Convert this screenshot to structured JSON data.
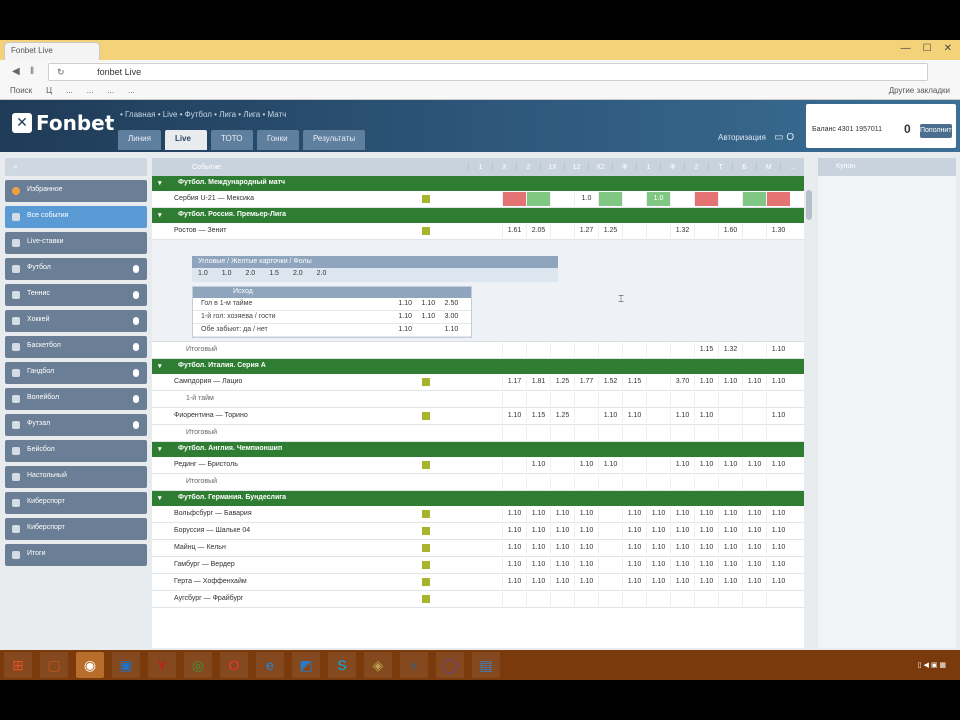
{
  "browser": {
    "tab_title": "Fonbet Live",
    "url_site": "fonbet Live",
    "nav_back": "◀",
    "nav_pause": "‖",
    "window_controls": [
      "—",
      "☐",
      "✕"
    ],
    "bookmarks": [
      "Поиск",
      "Ц",
      "...",
      "...",
      "...",
      "..."
    ],
    "bookmarks_right": "Другие закладки"
  },
  "site": {
    "logo": "Fonbet",
    "breadcrumb": "• Главная • Live • Футбол • Лига • Лига • Матч",
    "tabs": [
      {
        "label": "Линия"
      },
      {
        "label": "Live"
      },
      {
        "label": "ТОТО"
      },
      {
        "label": "Гонки"
      },
      {
        "label": "Результаты"
      }
    ],
    "header_right_label": "Авторизация",
    "header_right_icon": "▭ O",
    "account": {
      "id_label": "Баланс 4301 1957011",
      "balance": "0",
      "deposit_label": "Пополнить"
    }
  },
  "sidebar": {
    "search_icon": "search-icon",
    "items": [
      {
        "label": "Избранное",
        "icon": "orange"
      },
      {
        "label": "Все события",
        "icon": "default"
      },
      {
        "label": "Live-ставки",
        "icon": "default"
      },
      {
        "label": "Футбол",
        "icon": "default"
      },
      {
        "label": "Теннис",
        "icon": "default"
      },
      {
        "label": "Хоккей",
        "icon": "default"
      },
      {
        "label": "Баскетбол",
        "icon": "default"
      },
      {
        "label": "Гандбол",
        "icon": "default"
      },
      {
        "label": "Волейбол",
        "icon": "default"
      },
      {
        "label": "Футзал",
        "icon": "default"
      },
      {
        "label": "Бейсбол",
        "icon": "default"
      },
      {
        "label": "Настольный",
        "icon": "default"
      },
      {
        "label": "Киберспорт",
        "icon": "default"
      },
      {
        "label": "Киберспорт",
        "icon": "default"
      },
      {
        "label": "Итоги",
        "icon": "default"
      }
    ]
  },
  "table": {
    "header_label": "Событие",
    "columns": [
      "1",
      "X",
      "2",
      "1X",
      "12",
      "X2",
      "Ф",
      "1",
      "Ф",
      "2",
      "Т",
      "Б",
      "М",
      "..."
    ],
    "rows": [
      {
        "type": "section",
        "label": "Футбол. Международный матч"
      },
      {
        "type": "event",
        "name": "Сербия U-21 — Мексика",
        "odds": [
          "",
          "",
          "",
          "1.0",
          "",
          "",
          "1.0",
          "",
          "",
          "",
          "",
          ""
        ],
        "hl": [
          "r",
          "g",
          "",
          "",
          "g",
          "",
          "g",
          "",
          "r",
          "",
          "g",
          "r"
        ]
      },
      {
        "type": "section",
        "label": "Футбол. Россия. Премьер-Лига"
      },
      {
        "type": "event",
        "name": "Ростов — Зенит",
        "odds": [
          "1.61",
          "2.05",
          "",
          "1.27",
          "1.25",
          "",
          "",
          "1.32",
          "",
          "1.60",
          "",
          "1.30"
        ],
        "hl": []
      },
      {
        "type": "expand"
      },
      {
        "type": "sub",
        "name": "Итоговый",
        "odds": [
          "",
          "",
          "",
          "",
          "",
          "",
          "",
          "",
          "1.15",
          "1.32",
          "",
          "1.10"
        ],
        "hl": []
      },
      {
        "type": "section",
        "label": "Футбол. Италия. Серия А"
      },
      {
        "type": "event",
        "name": "Сампдория — Лацио",
        "odds": [
          "1.17",
          "1.81",
          "1.25",
          "1.77",
          "1.52",
          "1.15",
          "",
          "3.70",
          "1.10",
          "1.10",
          "1.10",
          "1.10"
        ],
        "hl": []
      },
      {
        "type": "sub",
        "name": "1-й тайм",
        "odds": [
          "",
          "",
          "",
          "",
          "",
          "",
          "",
          "",
          "",
          "",
          "",
          ""
        ],
        "hl": []
      },
      {
        "type": "event",
        "name": "Фиорентина — Торино",
        "odds": [
          "1.10",
          "1.15",
          "1.25",
          "",
          "1.10",
          "1.10",
          "",
          "1.10",
          "1.10",
          "",
          "",
          "1.10"
        ],
        "hl": []
      },
      {
        "type": "sub",
        "name": "Итоговый",
        "odds": [
          "",
          "",
          "",
          "",
          "",
          "",
          "",
          "",
          "",
          "",
          "",
          ""
        ],
        "hl": []
      },
      {
        "type": "section",
        "label": "Футбол. Англия. Чемпионшип"
      },
      {
        "type": "event",
        "name": "Рединг — Бристоль",
        "odds": [
          "",
          "1.10",
          "",
          "1.10",
          "1.10",
          "",
          "",
          "1.10",
          "1.10",
          "1.10",
          "1.10",
          "1.10"
        ],
        "hl": []
      },
      {
        "type": "sub",
        "name": "Итоговый",
        "odds": [
          "",
          "",
          "",
          "",
          "",
          "",
          "",
          "",
          "",
          "",
          "",
          ""
        ],
        "hl": []
      },
      {
        "type": "section",
        "label": "Футбол. Германия. Бундеслига"
      },
      {
        "type": "event",
        "name": "Вольфсбург — Бавария",
        "odds": [
          "1.10",
          "1.10",
          "1.10",
          "1.10",
          "",
          "1.10",
          "1.10",
          "1.10",
          "1.10",
          "1.10",
          "1.10",
          "1.10"
        ],
        "hl": []
      },
      {
        "type": "event",
        "name": "Боруссия — Шальке 04",
        "odds": [
          "1.10",
          "1.10",
          "1.10",
          "1.10",
          "",
          "1.10",
          "1.10",
          "1.10",
          "1.10",
          "1.10",
          "1.10",
          "1.10"
        ],
        "hl": []
      },
      {
        "type": "event",
        "name": "Майнц — Кельн",
        "odds": [
          "1.10",
          "1.10",
          "1.10",
          "1.10",
          "",
          "1.10",
          "1.10",
          "1.10",
          "1.10",
          "1.10",
          "1.10",
          "1.10"
        ],
        "hl": []
      },
      {
        "type": "event",
        "name": "Гамбург — Вердер",
        "odds": [
          "1.10",
          "1.10",
          "1.10",
          "1.10",
          "",
          "1.10",
          "1.10",
          "1.10",
          "1.10",
          "1.10",
          "1.10",
          "1.10"
        ],
        "hl": []
      },
      {
        "type": "event",
        "name": "Герта — Хоффенхайм",
        "odds": [
          "1.10",
          "1.10",
          "1.10",
          "1.10",
          "",
          "1.10",
          "1.10",
          "1.10",
          "1.10",
          "1.10",
          "1.10",
          "1.10"
        ],
        "hl": []
      },
      {
        "type": "event",
        "name": "Аугсбург — Фрайбург",
        "odds": [
          "",
          "",
          "",
          "",
          "",
          "",
          "",
          "",
          "",
          "",
          "",
          ""
        ],
        "hl": []
      }
    ],
    "expand": {
      "wide_header": "Угловые / Желтые карточки / Фолы",
      "wide_values": [
        "1.0",
        "1.0",
        "2.0",
        "1.5",
        "2.0",
        "2.0"
      ],
      "small_header": "Исход",
      "small_rows": [
        {
          "name": "Гол в 1-м тайме",
          "c": [
            "1.10",
            "1.10",
            "2.50"
          ]
        },
        {
          "name": "1-й гол: хозяева / гости",
          "c": [
            "1.10",
            "1.10",
            "3.00"
          ]
        },
        {
          "name": "Обе забьют: да / нет",
          "c": [
            "1.10",
            "",
            "1.10"
          ]
        }
      ]
    }
  },
  "right_panel": {
    "header": "Купон"
  },
  "taskbar": {
    "icons": [
      "⊞",
      "▢",
      "◉",
      "▣",
      "Y",
      "◎",
      "O",
      "e",
      "◩",
      "S",
      "◈",
      "♦",
      "◯",
      "▤"
    ],
    "tray": "▯ ◀ ▣ ▦"
  },
  "colors": {
    "section_green": "#2e7d32",
    "header_blue": "#2d567a",
    "taskbar": "#7a3a0c"
  }
}
